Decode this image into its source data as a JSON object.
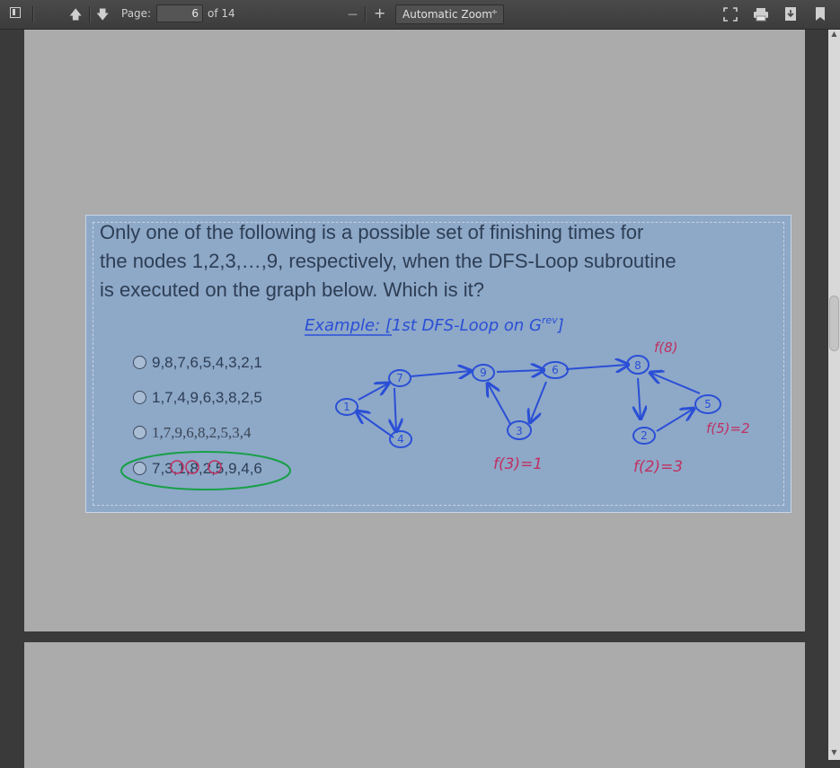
{
  "toolbar": {
    "page_label": "Page:",
    "page_number": "6",
    "page_count": "of 14",
    "zoom_out": "—",
    "zoom_in": "+",
    "zoom_value": "Automatic Zoom",
    "zoom_caret": "÷",
    "up_glyph": "🡅",
    "down_glyph": "🡇"
  },
  "slide": {
    "question_line1": "Only one of the following is a possible set of finishing times for",
    "question_line2": "the nodes 1,2,3,…,9, respectively, when the DFS-Loop subroutine",
    "question_line3": "is executed on the graph below.  Which is it?",
    "options": [
      "9,8,7,6,5,4,3,2,1",
      "1,7,4,9,6,3,8,2,5",
      "1,7,9,6,8,2,5,3,4",
      "7,3,1,8,2,5,9,4,6"
    ],
    "annotation_title": "Example: [1st DFS-Loop on G",
    "annotation_sup": "rev",
    "annotation_close": "]",
    "nodes": [
      "1",
      "7",
      "4",
      "9",
      "6",
      "3",
      "8",
      "2",
      "5"
    ],
    "f8": "f(8)",
    "f5": "f(5)=2",
    "f3": "f(3)=1",
    "f2": "f(2)=3"
  },
  "colors": {
    "ink_blue": "#2a4fd6",
    "ink_red": "#c03060",
    "ink_green": "#18a048",
    "slide_bg": "#8ea8c8"
  }
}
